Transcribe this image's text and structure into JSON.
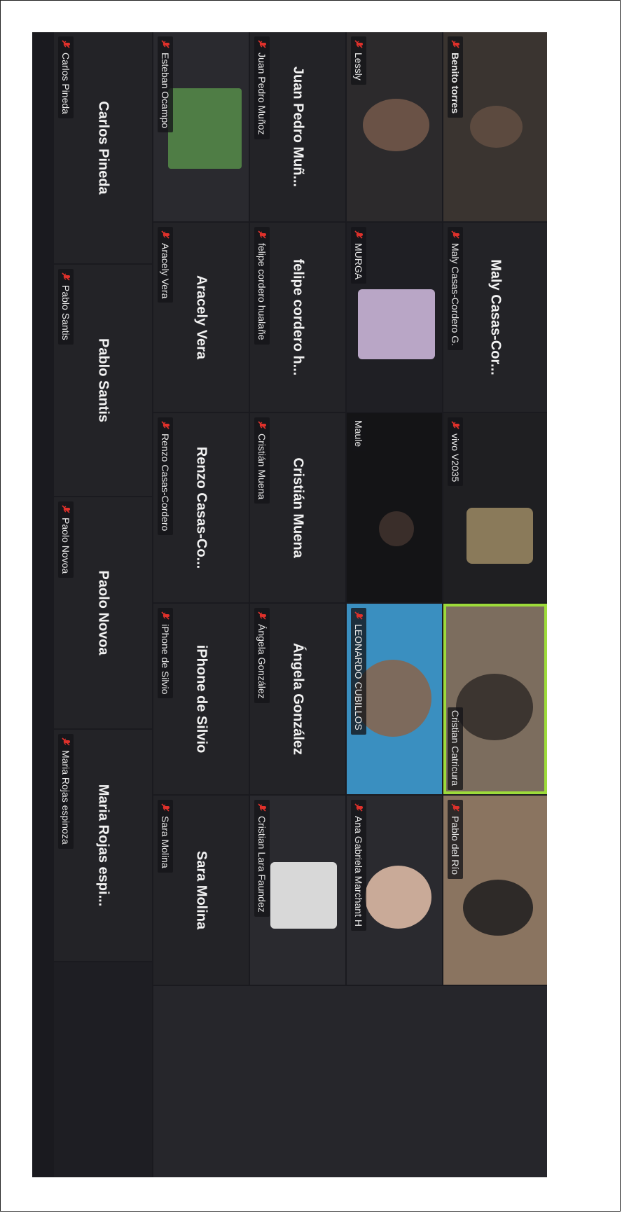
{
  "participants": [
    {
      "id": "benito",
      "label": "Benito torres"
    },
    {
      "id": "maly",
      "display": "Maly  Casas-Cor...",
      "label": "Maly Casas-Cordero G."
    },
    {
      "id": "vivo",
      "label": "vivo V2035"
    },
    {
      "id": "cristianc",
      "label": "Cristian Catricura"
    },
    {
      "id": "pablorio",
      "label": "Pablo del Río"
    },
    {
      "id": "lessly",
      "label": "Lessly"
    },
    {
      "id": "murga",
      "label": "MURGA"
    },
    {
      "id": "maule",
      "label": "Maule"
    },
    {
      "id": "leonardo",
      "label": "LEONARDO CUBILLOS"
    },
    {
      "id": "anagab",
      "label": "Ana Gabriela Marchant H"
    },
    {
      "id": "juanpedro",
      "display": "Juan Pedro Muñ...",
      "label": "Juan Pedro Muñoz"
    },
    {
      "id": "felipe",
      "display": "felipe cordero h...",
      "label": "felipe cordero hualañe"
    },
    {
      "id": "cmuena",
      "display": "Cristián Muena",
      "label": "Cristián Muena"
    },
    {
      "id": "angela",
      "display": "Ángela González",
      "label": "Ángela González"
    },
    {
      "id": "cristianlara",
      "label": "Cristian Lara Faundez"
    },
    {
      "id": "esteban",
      "label": "Esteban Ocampo"
    },
    {
      "id": "aracely",
      "display": "Aracely Vera",
      "label": "Aracely Vera"
    },
    {
      "id": "renzo",
      "display": "Renzo  Casas-Co...",
      "label": "Renzo Casas-Cordero"
    },
    {
      "id": "iphone",
      "display": "iPhone de Silvio",
      "label": "iPhone de Silvio"
    },
    {
      "id": "sara",
      "display": "Sara Molina",
      "label": "Sara Molina"
    },
    {
      "id": "carlos",
      "display": "Carlos Pineda",
      "label": "Carlos Pineda"
    },
    {
      "id": "pablos",
      "display": "Pablo Santis",
      "label": "Pablo Santis"
    },
    {
      "id": "paolo",
      "display": "Paolo Novoa",
      "label": "Paolo Novoa"
    },
    {
      "id": "maria",
      "display": "Maria  Rojas espi...",
      "label": "Maria Rojas espinoza"
    }
  ],
  "colors": {
    "tile_bg": "#232327",
    "active_speaker_border": "#9ddb3a",
    "mute_icon": "#e0312b",
    "text": "#f2f2f2"
  },
  "icons": {
    "mute": "microphone-muted-icon"
  }
}
